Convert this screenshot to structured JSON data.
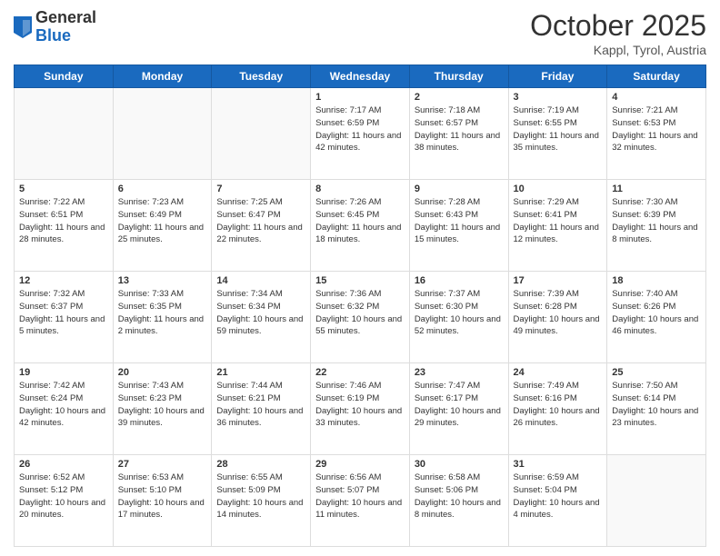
{
  "logo": {
    "general": "General",
    "blue": "Blue"
  },
  "title": "October 2025",
  "subtitle": "Kappl, Tyrol, Austria",
  "days_of_week": [
    "Sunday",
    "Monday",
    "Tuesday",
    "Wednesday",
    "Thursday",
    "Friday",
    "Saturday"
  ],
  "weeks": [
    [
      {
        "day": "",
        "sunrise": "",
        "sunset": "",
        "daylight": ""
      },
      {
        "day": "",
        "sunrise": "",
        "sunset": "",
        "daylight": ""
      },
      {
        "day": "",
        "sunrise": "",
        "sunset": "",
        "daylight": ""
      },
      {
        "day": "1",
        "sunrise": "Sunrise: 7:17 AM",
        "sunset": "Sunset: 6:59 PM",
        "daylight": "Daylight: 11 hours and 42 minutes."
      },
      {
        "day": "2",
        "sunrise": "Sunrise: 7:18 AM",
        "sunset": "Sunset: 6:57 PM",
        "daylight": "Daylight: 11 hours and 38 minutes."
      },
      {
        "day": "3",
        "sunrise": "Sunrise: 7:19 AM",
        "sunset": "Sunset: 6:55 PM",
        "daylight": "Daylight: 11 hours and 35 minutes."
      },
      {
        "day": "4",
        "sunrise": "Sunrise: 7:21 AM",
        "sunset": "Sunset: 6:53 PM",
        "daylight": "Daylight: 11 hours and 32 minutes."
      }
    ],
    [
      {
        "day": "5",
        "sunrise": "Sunrise: 7:22 AM",
        "sunset": "Sunset: 6:51 PM",
        "daylight": "Daylight: 11 hours and 28 minutes."
      },
      {
        "day": "6",
        "sunrise": "Sunrise: 7:23 AM",
        "sunset": "Sunset: 6:49 PM",
        "daylight": "Daylight: 11 hours and 25 minutes."
      },
      {
        "day": "7",
        "sunrise": "Sunrise: 7:25 AM",
        "sunset": "Sunset: 6:47 PM",
        "daylight": "Daylight: 11 hours and 22 minutes."
      },
      {
        "day": "8",
        "sunrise": "Sunrise: 7:26 AM",
        "sunset": "Sunset: 6:45 PM",
        "daylight": "Daylight: 11 hours and 18 minutes."
      },
      {
        "day": "9",
        "sunrise": "Sunrise: 7:28 AM",
        "sunset": "Sunset: 6:43 PM",
        "daylight": "Daylight: 11 hours and 15 minutes."
      },
      {
        "day": "10",
        "sunrise": "Sunrise: 7:29 AM",
        "sunset": "Sunset: 6:41 PM",
        "daylight": "Daylight: 11 hours and 12 minutes."
      },
      {
        "day": "11",
        "sunrise": "Sunrise: 7:30 AM",
        "sunset": "Sunset: 6:39 PM",
        "daylight": "Daylight: 11 hours and 8 minutes."
      }
    ],
    [
      {
        "day": "12",
        "sunrise": "Sunrise: 7:32 AM",
        "sunset": "Sunset: 6:37 PM",
        "daylight": "Daylight: 11 hours and 5 minutes."
      },
      {
        "day": "13",
        "sunrise": "Sunrise: 7:33 AM",
        "sunset": "Sunset: 6:35 PM",
        "daylight": "Daylight: 11 hours and 2 minutes."
      },
      {
        "day": "14",
        "sunrise": "Sunrise: 7:34 AM",
        "sunset": "Sunset: 6:34 PM",
        "daylight": "Daylight: 10 hours and 59 minutes."
      },
      {
        "day": "15",
        "sunrise": "Sunrise: 7:36 AM",
        "sunset": "Sunset: 6:32 PM",
        "daylight": "Daylight: 10 hours and 55 minutes."
      },
      {
        "day": "16",
        "sunrise": "Sunrise: 7:37 AM",
        "sunset": "Sunset: 6:30 PM",
        "daylight": "Daylight: 10 hours and 52 minutes."
      },
      {
        "day": "17",
        "sunrise": "Sunrise: 7:39 AM",
        "sunset": "Sunset: 6:28 PM",
        "daylight": "Daylight: 10 hours and 49 minutes."
      },
      {
        "day": "18",
        "sunrise": "Sunrise: 7:40 AM",
        "sunset": "Sunset: 6:26 PM",
        "daylight": "Daylight: 10 hours and 46 minutes."
      }
    ],
    [
      {
        "day": "19",
        "sunrise": "Sunrise: 7:42 AM",
        "sunset": "Sunset: 6:24 PM",
        "daylight": "Daylight: 10 hours and 42 minutes."
      },
      {
        "day": "20",
        "sunrise": "Sunrise: 7:43 AM",
        "sunset": "Sunset: 6:23 PM",
        "daylight": "Daylight: 10 hours and 39 minutes."
      },
      {
        "day": "21",
        "sunrise": "Sunrise: 7:44 AM",
        "sunset": "Sunset: 6:21 PM",
        "daylight": "Daylight: 10 hours and 36 minutes."
      },
      {
        "day": "22",
        "sunrise": "Sunrise: 7:46 AM",
        "sunset": "Sunset: 6:19 PM",
        "daylight": "Daylight: 10 hours and 33 minutes."
      },
      {
        "day": "23",
        "sunrise": "Sunrise: 7:47 AM",
        "sunset": "Sunset: 6:17 PM",
        "daylight": "Daylight: 10 hours and 29 minutes."
      },
      {
        "day": "24",
        "sunrise": "Sunrise: 7:49 AM",
        "sunset": "Sunset: 6:16 PM",
        "daylight": "Daylight: 10 hours and 26 minutes."
      },
      {
        "day": "25",
        "sunrise": "Sunrise: 7:50 AM",
        "sunset": "Sunset: 6:14 PM",
        "daylight": "Daylight: 10 hours and 23 minutes."
      }
    ],
    [
      {
        "day": "26",
        "sunrise": "Sunrise: 6:52 AM",
        "sunset": "Sunset: 5:12 PM",
        "daylight": "Daylight: 10 hours and 20 minutes."
      },
      {
        "day": "27",
        "sunrise": "Sunrise: 6:53 AM",
        "sunset": "Sunset: 5:10 PM",
        "daylight": "Daylight: 10 hours and 17 minutes."
      },
      {
        "day": "28",
        "sunrise": "Sunrise: 6:55 AM",
        "sunset": "Sunset: 5:09 PM",
        "daylight": "Daylight: 10 hours and 14 minutes."
      },
      {
        "day": "29",
        "sunrise": "Sunrise: 6:56 AM",
        "sunset": "Sunset: 5:07 PM",
        "daylight": "Daylight: 10 hours and 11 minutes."
      },
      {
        "day": "30",
        "sunrise": "Sunrise: 6:58 AM",
        "sunset": "Sunset: 5:06 PM",
        "daylight": "Daylight: 10 hours and 8 minutes."
      },
      {
        "day": "31",
        "sunrise": "Sunrise: 6:59 AM",
        "sunset": "Sunset: 5:04 PM",
        "daylight": "Daylight: 10 hours and 4 minutes."
      },
      {
        "day": "",
        "sunrise": "",
        "sunset": "",
        "daylight": ""
      }
    ]
  ]
}
